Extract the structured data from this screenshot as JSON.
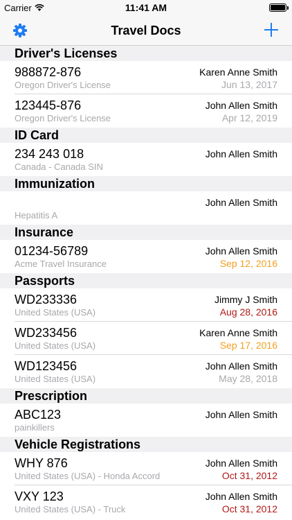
{
  "status": {
    "carrier": "Carrier",
    "time": "11:41 AM"
  },
  "nav": {
    "title": "Travel Docs",
    "left_icon": "gear-icon",
    "right_icon": "plus-icon"
  },
  "colors": {
    "accent": "#1e7cf2",
    "expiring": "#f0a021",
    "expired": "#b01818",
    "secondary": "#a8a8ad"
  },
  "sections": [
    {
      "header": "Driver's Licenses"
    },
    {
      "header": "ID Card"
    },
    {
      "header": "Immunization"
    },
    {
      "header": "Insurance"
    },
    {
      "header": "Passports"
    },
    {
      "header": "Prescription"
    },
    {
      "header": "Vehicle Registrations"
    }
  ],
  "rows": [
    {
      "title": "988872-876",
      "sub": "Oregon Driver's License",
      "name": "Karen Anne Smith",
      "date": "Jun 13, 2017",
      "status": "normal"
    },
    {
      "title": "123445-876",
      "sub": "Oregon Driver's License",
      "name": "John Allen Smith",
      "date": "Apr 12, 2019",
      "status": "normal"
    },
    {
      "title": "234 243 018",
      "sub": "Canada - Canada SIN",
      "name": "John Allen Smith",
      "date": "",
      "status": "normal"
    },
    {
      "title": "",
      "sub": "Hepatitis A",
      "name": "John Allen Smith",
      "date": "",
      "status": "normal"
    },
    {
      "title": "01234-56789",
      "sub": "Acme Travel Insurance",
      "name": "John Allen Smith",
      "date": "Sep 12, 2016",
      "status": "expiring"
    },
    {
      "title": "WD233336",
      "sub": "United States (USA)",
      "name": "Jimmy J Smith",
      "date": "Aug 28, 2016",
      "status": "expired"
    },
    {
      "title": "WD233456",
      "sub": "United States (USA)",
      "name": "Karen Anne Smith",
      "date": "Sep 17, 2016",
      "status": "expiring"
    },
    {
      "title": "WD123456",
      "sub": "United States (USA)",
      "name": "John Allen Smith",
      "date": "May 28, 2018",
      "status": "normal"
    },
    {
      "title": "ABC123",
      "sub": "painkillers",
      "name": "John Allen Smith",
      "date": "",
      "status": "normal"
    },
    {
      "title": "WHY 876",
      "sub": "United States (USA) - Honda Accord",
      "name": "John Allen Smith",
      "date": "Oct 31, 2012",
      "status": "expired"
    },
    {
      "title": "VXY 123",
      "sub": "United States (USA) - Truck",
      "name": "John Allen Smith",
      "date": "Oct 31, 2012",
      "status": "expired"
    }
  ]
}
